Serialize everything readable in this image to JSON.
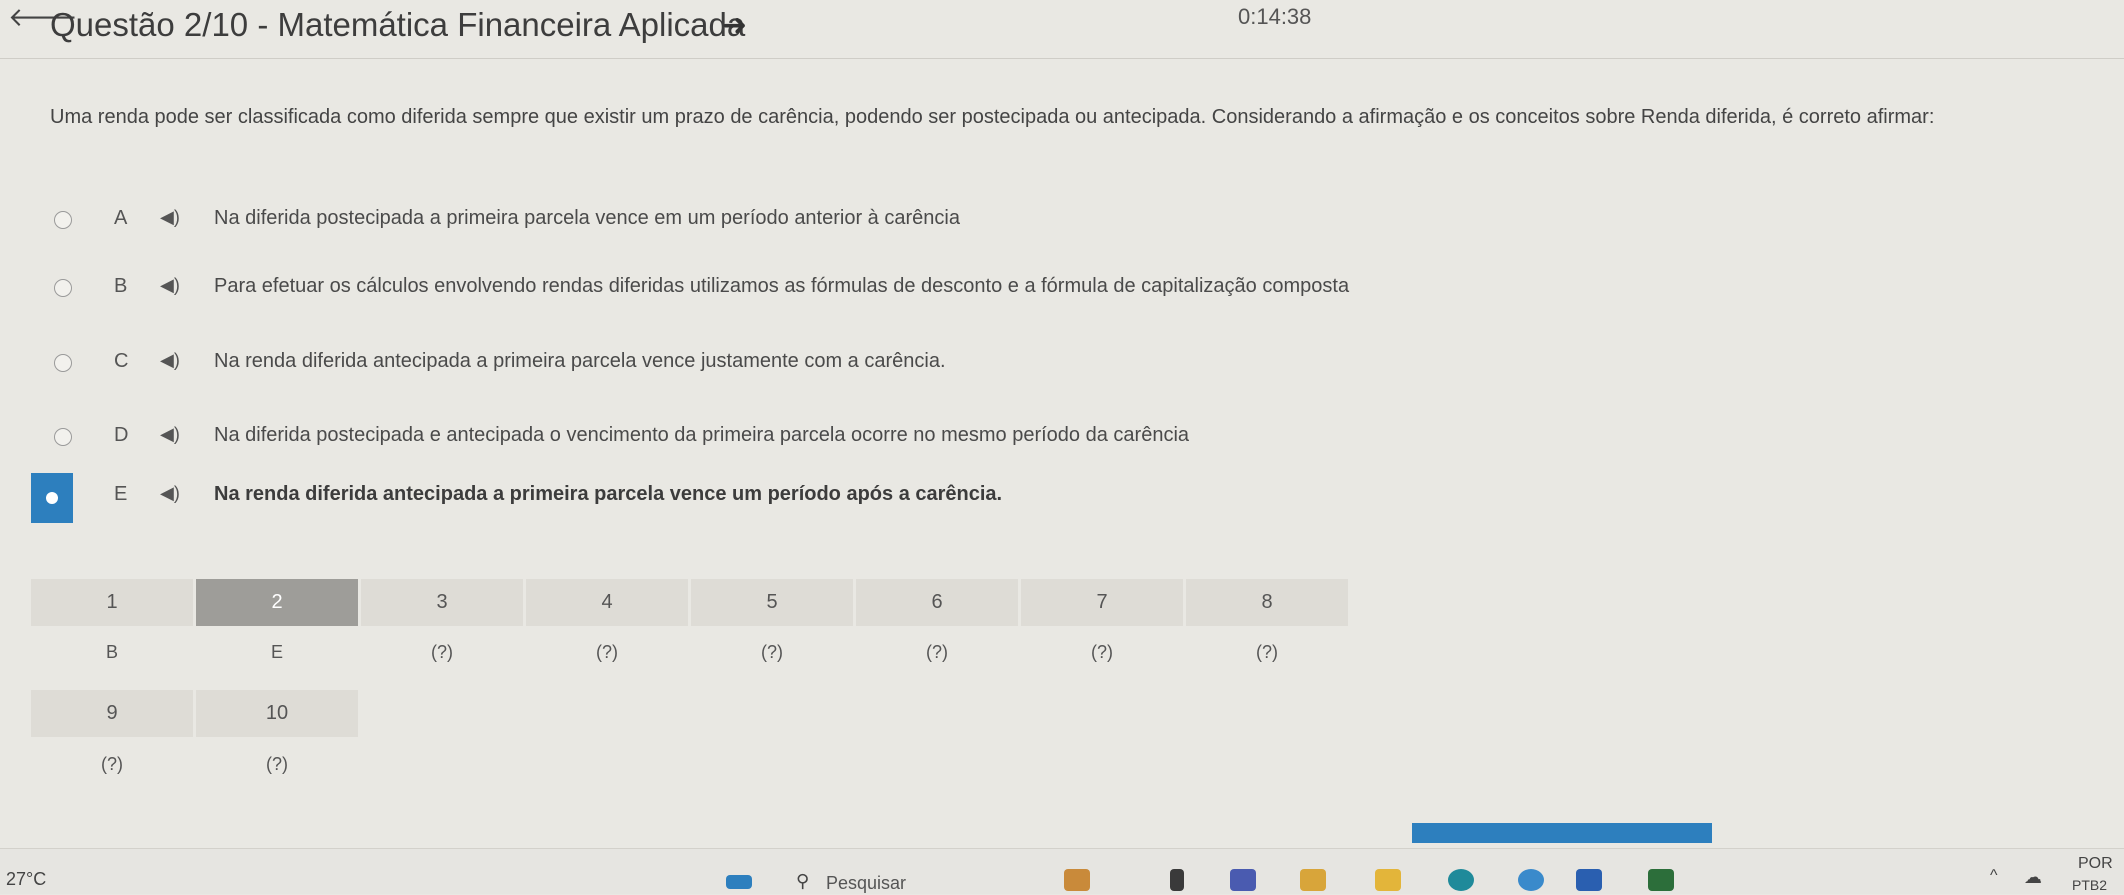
{
  "header": {
    "title": "Questão 2/10 - Matemática Financeira Aplicada",
    "timer": "0:14:38"
  },
  "question": {
    "text": "Uma renda pode ser classificada como diferida sempre que existir um prazo de carência, podendo ser postecipada ou antecipada. Considerando a afirmação e os conceitos sobre Renda diferida, é correto afirmar:"
  },
  "options": [
    {
      "letter": "A",
      "text": "Na diferida postecipada a primeira parcela vence em um período anterior à carência",
      "selected": false
    },
    {
      "letter": "B",
      "text": "Para efetuar os cálculos envolvendo rendas diferidas utilizamos as fórmulas de desconto e a fórmula de capitalização composta",
      "selected": false
    },
    {
      "letter": "C",
      "text": "Na renda diferida antecipada a primeira parcela vence justamente com a carência.",
      "selected": false
    },
    {
      "letter": "D",
      "text": "Na diferida postecipada e antecipada o vencimento da primeira parcela ocorre no mesmo período da carência",
      "selected": false
    },
    {
      "letter": "E",
      "text": "Na renda diferida antecipada a primeira parcela vence um período após a carência.",
      "selected": true
    }
  ],
  "answer_grid": {
    "row1_numbers": [
      "1",
      "2",
      "3",
      "4",
      "5",
      "6",
      "7",
      "8"
    ],
    "row1_answers": [
      "B",
      "E",
      "(?)",
      "(?)",
      "(?)",
      "(?)",
      "(?)",
      "(?)"
    ],
    "row2_numbers": [
      "9",
      "10"
    ],
    "row2_answers": [
      "(?)",
      "(?)"
    ],
    "active_question": "2"
  },
  "taskbar": {
    "temperature": "27°C",
    "search_placeholder": "Pesquisar",
    "language": "POR",
    "keyboard": "PTB2"
  },
  "colors": {
    "accent": "#2d7fbe",
    "background": "#e9e8e3",
    "active_cell": "#9e9d99"
  }
}
